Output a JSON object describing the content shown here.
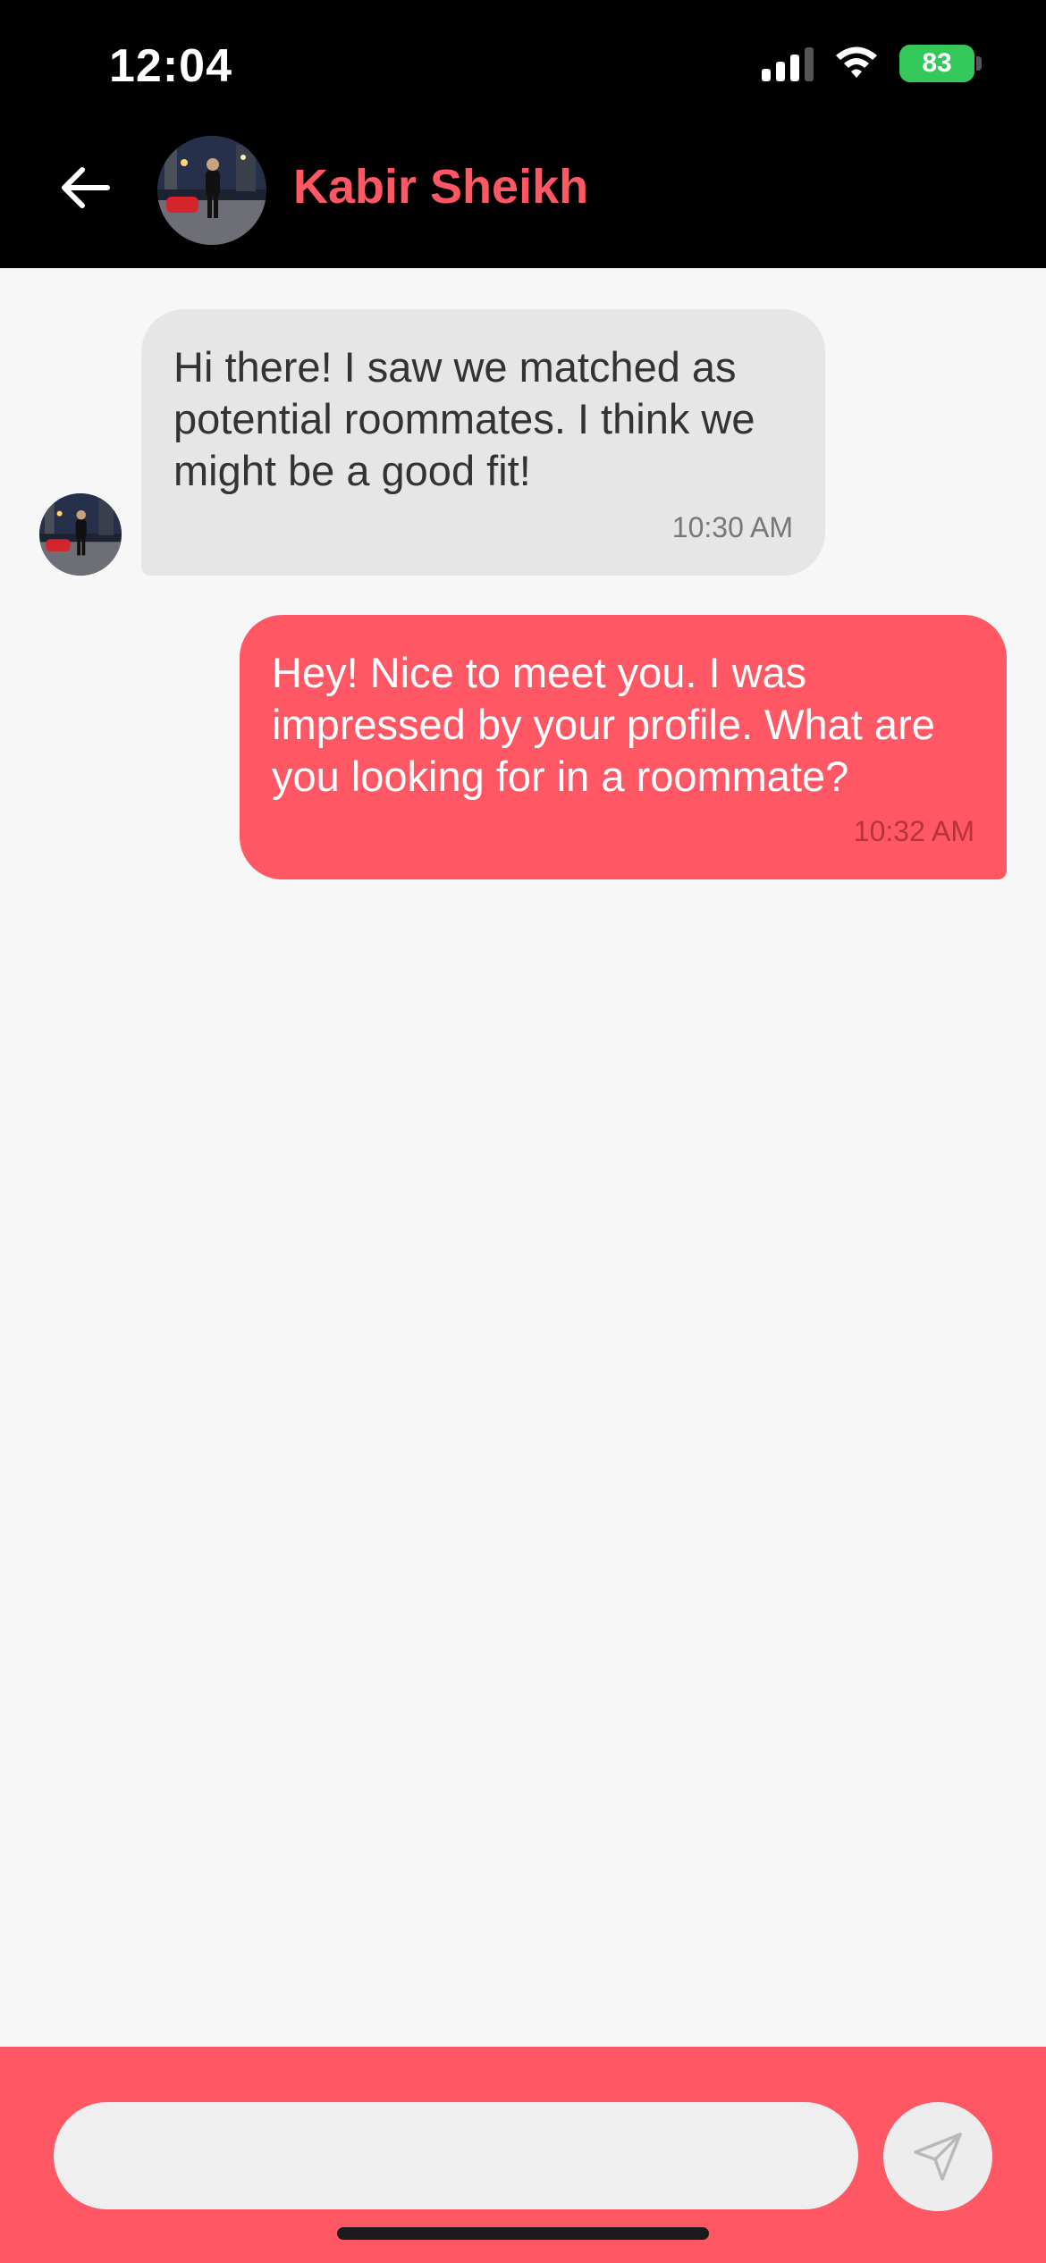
{
  "status_bar": {
    "time": "12:04",
    "battery": "83"
  },
  "header": {
    "contact_name": "Kabir Sheikh",
    "back_icon": "arrow-left-icon"
  },
  "messages": [
    {
      "direction": "incoming",
      "text": "Hi there! I saw we matched as potential roommates. I think we might be a good fit!",
      "time": "10:30 AM"
    },
    {
      "direction": "outgoing",
      "text": "Hey! Nice to meet you. I was impressed by your profile. What are you looking for in a roommate?",
      "time": "10:32 AM"
    }
  ],
  "composer": {
    "input_value": "",
    "send_icon": "send-icon"
  },
  "colors": {
    "accent": "#ff5864",
    "header_bg": "#000000",
    "incoming_bubble": "#e6e6e6",
    "chat_bg": "#f7f7f7",
    "battery": "#34c759"
  }
}
